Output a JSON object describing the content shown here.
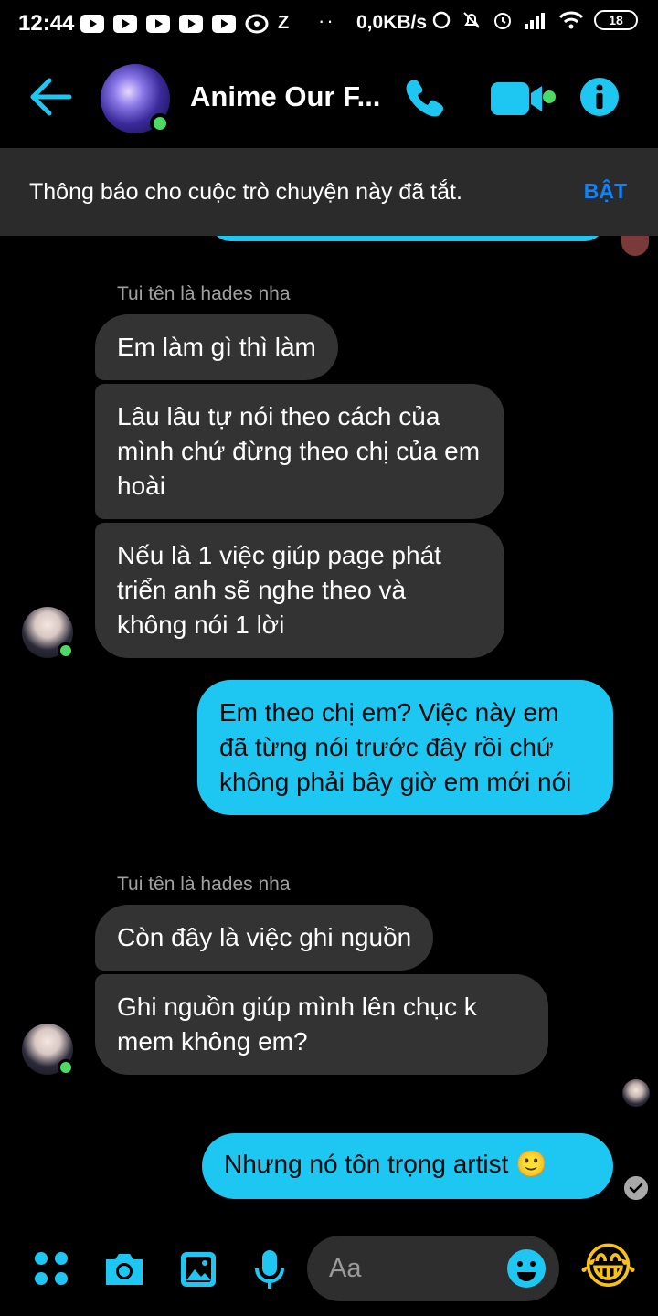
{
  "status_bar": {
    "time": "12:44",
    "misc_z": "Z",
    "network_speed": "0,0KB/s",
    "battery": "18"
  },
  "header": {
    "title": "Anime Our F...",
    "accent_color": "#1ec6f2"
  },
  "notice": {
    "text": "Thông báo cho cuộc trò chuyện này đã tắt.",
    "action_label": "BẬT"
  },
  "messages": {
    "group1_sender": "Tui tên là hades nha",
    "group1": [
      "Em làm gì thì làm",
      "Lâu lâu tự nói theo cách của mình chứ đừng theo chị của em hoài",
      "Nếu là 1 việc giúp page phát triển anh sẽ nghe theo và không nói 1 lời"
    ],
    "outgoing1": "Em theo chị em? Việc này em đã từng nói trước đây rồi chứ không phải bây giờ em mới nói",
    "group2_sender": "Tui tên là hades nha",
    "group2": [
      "Còn đây là việc ghi nguồn",
      "Ghi nguồn giúp mình lên chục k mem không em?"
    ],
    "outgoing2": "Nhưng nó tôn trọng artist",
    "outgoing2_emoji": "🙂"
  },
  "composer": {
    "placeholder": "Aa",
    "reaction_emoji": "😂"
  }
}
